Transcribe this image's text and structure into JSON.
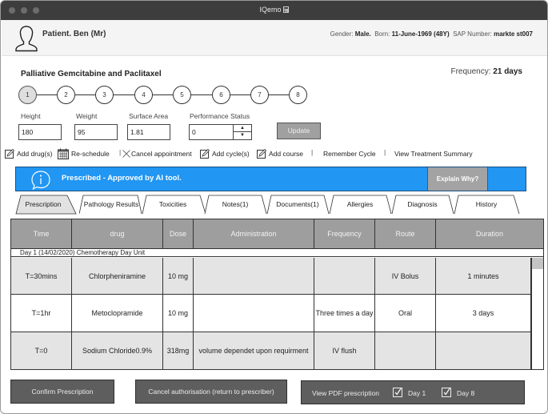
{
  "window": {
    "title": "IQemo"
  },
  "patient": {
    "name": "Patient. Ben (Mr)",
    "gender_label": "Gender:",
    "gender": "Male.",
    "born_label": "Born:",
    "born": "11-June-1969 (48Y)",
    "sap_label": "SAP Number:",
    "sap": "markte st007"
  },
  "regimen": {
    "title": "Palliative Gemcitabine and Paclitaxel",
    "frequency_label": "Frequency:",
    "frequency": "21 days",
    "cycles": [
      "1",
      "2",
      "3",
      "4",
      "5",
      "6",
      "7",
      "8"
    ],
    "active_cycle": "1"
  },
  "measurements": {
    "height_label": "Height",
    "height": "180",
    "weight_label": "Weight",
    "weight": "95",
    "surface_label": "Surface Area",
    "surface": "1.81",
    "performance_label": "Performance Status",
    "performance": "0",
    "update_label": "Update"
  },
  "toolbar": {
    "add_drug": "Add drug(s)",
    "reschedule": "Re-schedule",
    "cancel_appointment": "Cancel appointment",
    "add_cycle": "Add cycle(s)",
    "add_course": "Add course",
    "remember_cycle": "Remember Cycle",
    "view_summary": "View Treatment Summary",
    "separator": "|"
  },
  "banner": {
    "message": "Prescribed - Approved by AI tool.",
    "explain_label": "Explain Why?",
    "color": "#2196f3"
  },
  "tabs": [
    {
      "label": "Prescription",
      "active": true
    },
    {
      "label": "Pathology Results",
      "active": false
    },
    {
      "label": "Toxicities",
      "active": false
    },
    {
      "label": "Notes(1)",
      "active": false
    },
    {
      "label": "Documents(1)",
      "active": false
    },
    {
      "label": "Allergies",
      "active": false
    },
    {
      "label": "Diagnosis",
      "active": false
    },
    {
      "label": "History",
      "active": false
    }
  ],
  "table": {
    "columns": [
      "Time",
      "drug",
      "Dose",
      "Administration",
      "Frequency",
      "Route",
      "Duration"
    ],
    "day_header": "Day 1 (14/02/2020) Chemotherapy Day Unit",
    "rows": [
      [
        "T=30mins",
        "Chlorpheniramine",
        "10 mg",
        "",
        "",
        "IV Bolus",
        "1 minutes"
      ],
      [
        "T=1hr",
        "Metoclopramide",
        "10 mg",
        "",
        "Three times a day",
        "Oral",
        "3 days"
      ],
      [
        "T=0",
        "Sodium Chloride0.9%",
        "318mg",
        "volume dependet upon requirment",
        "IV flush",
        "",
        ""
      ]
    ]
  },
  "footer": {
    "confirm_label": "Confirm Prescription",
    "cancel_auth_label": "Cancel authorisation (return to prescriber)",
    "view_pdf_label": "View PDF prescription",
    "day1_label": "Day 1",
    "day1_checked": true,
    "day8_label": "Day 8",
    "day8_checked": true
  }
}
